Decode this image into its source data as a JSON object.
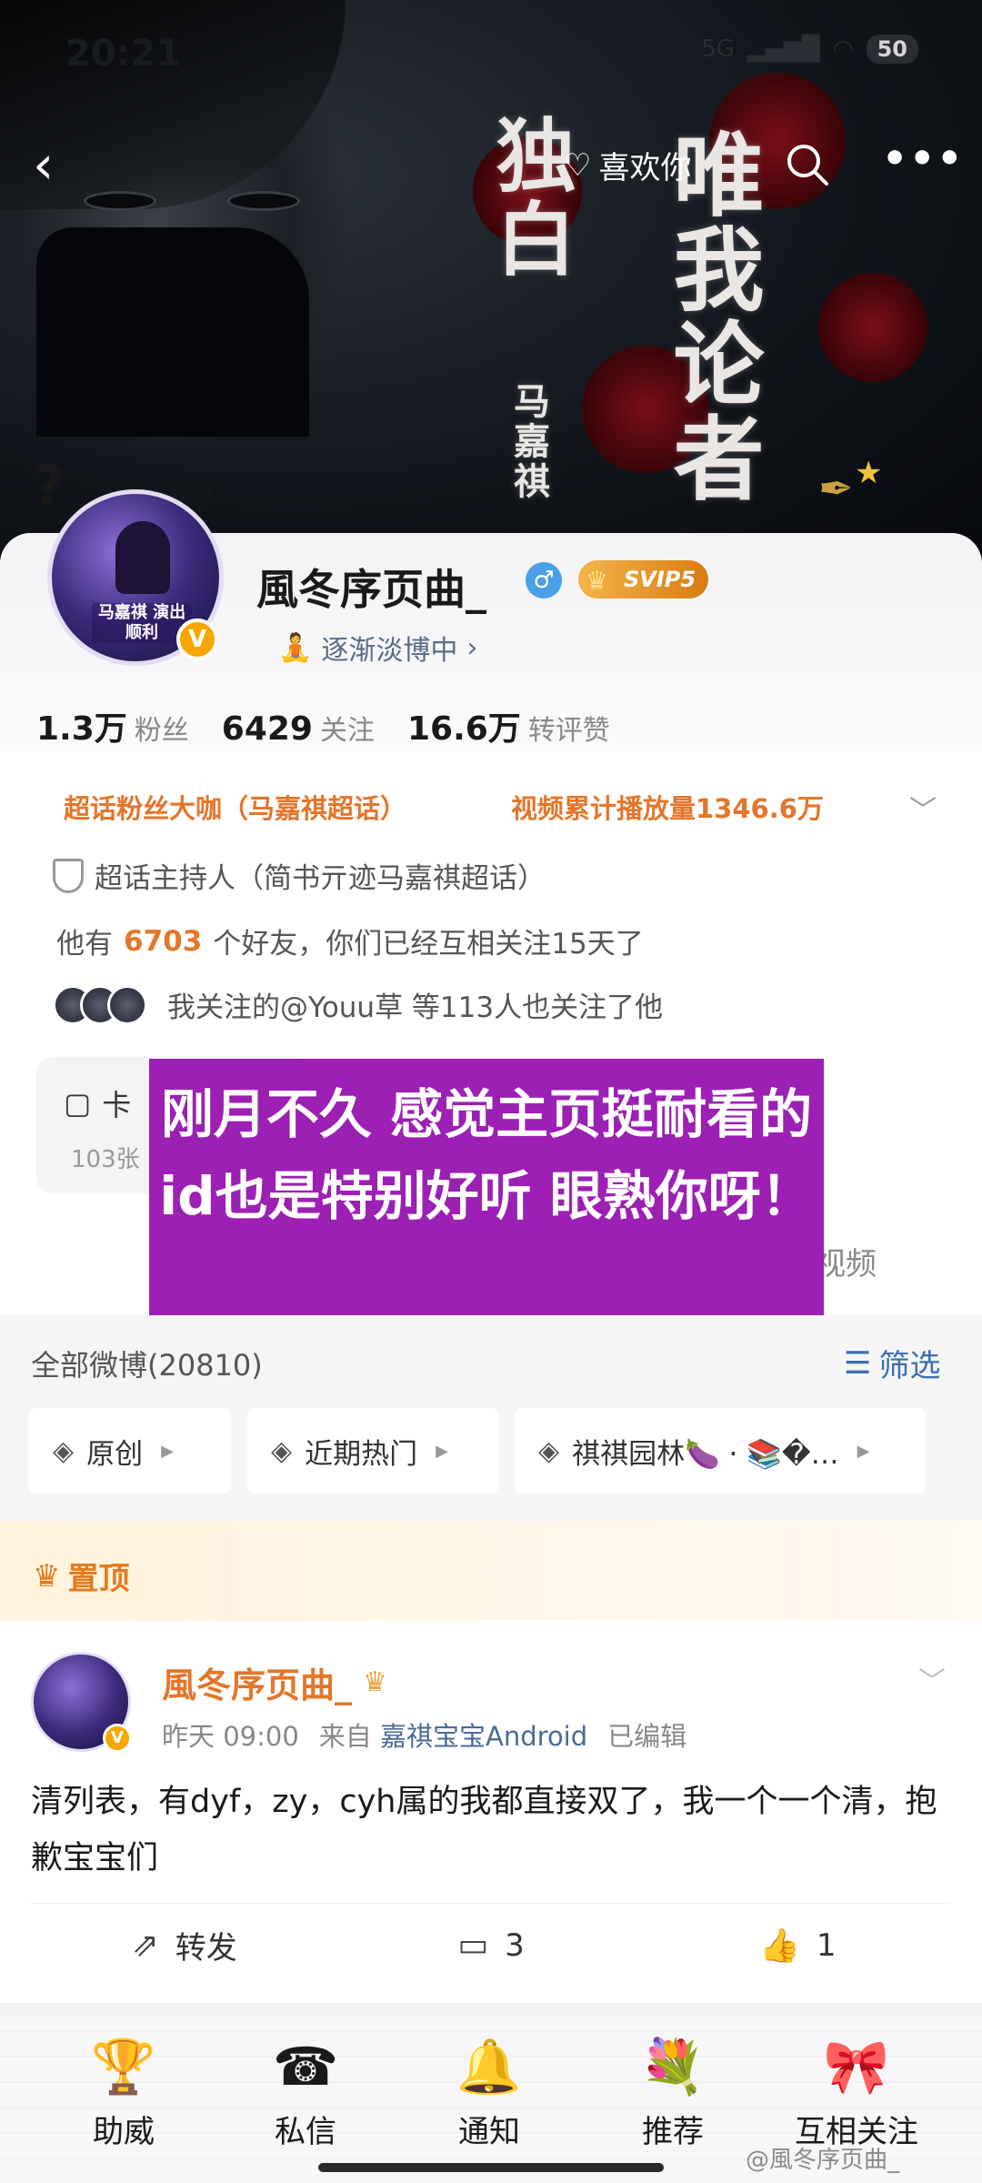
{
  "status_bar": {
    "time": "20:21",
    "network": "5G",
    "battery": "50"
  },
  "cover": {
    "title_left": "独白",
    "title_right": "唯我论者",
    "artist": "马嘉祺"
  },
  "top_nav": {
    "back_icon": "back-chevron-icon",
    "like_label": "喜欢你",
    "search_icon": "search-icon",
    "more_icon": "more-icon"
  },
  "profile": {
    "avatar_caption": "马嘉祺 演出顺利",
    "verified_mark": "V",
    "username": "風冬序页曲_",
    "gender_symbol": "♂",
    "vip_label": "SVIP5",
    "status": "逐渐淡博中",
    "status_chevron": "›",
    "stats": [
      {
        "value": "1.3万",
        "label": "粉丝"
      },
      {
        "value": "6429",
        "label": "关注"
      },
      {
        "value": "16.6万",
        "label": "转评赞"
      }
    ],
    "honor_1": "超话粉丝大咖（马嘉祺超话）",
    "honor_2": "视频累计播放量1346.6万",
    "host_line": "超话主持人（简书亓迹马嘉祺超话）",
    "friends_prefix": "他有",
    "friends_count": "6703",
    "friends_suffix": "个好友，你们已经互相关注15天了",
    "mutual_line": "我关注的@Youu草 等113人也关注了他",
    "card_box_title": "卡",
    "card_box_sub": "103张",
    "video_label": "视频"
  },
  "overlay_text": "刚月不久 感觉主页挺耐看的 id也是特别好听 眼熟你呀！",
  "feed": {
    "title": "全部微博(20810)",
    "filter_label": "筛选",
    "chips": [
      {
        "label": "原创"
      },
      {
        "label": "近期热门"
      },
      {
        "label": "祺祺园林🍆 · 📚�…"
      }
    ]
  },
  "pinned": {
    "label": "置顶"
  },
  "post": {
    "author": "風冬序页曲_",
    "time": "昨天 09:00",
    "source_prefix": "来自",
    "source": "嘉祺宝宝Android",
    "edited": "已编辑",
    "text": "清列表，有dyf，zy，cyh属的我都直接双了，我一个一个清，抱歉宝宝们",
    "repost_label": "转发",
    "comment_count": "3",
    "like_count": "1"
  },
  "bottom_tabs": [
    {
      "label": "助威",
      "icon": "trophy-icon"
    },
    {
      "label": "私信",
      "icon": "telephone-icon"
    },
    {
      "label": "通知",
      "icon": "bell-icon"
    },
    {
      "label": "推荐",
      "icon": "bouquet-icon"
    },
    {
      "label": "互相关注",
      "icon": "ribbon-icon"
    }
  ],
  "watermark": "@風冬序页曲_",
  "colors": {
    "accent_orange": "#e4762a",
    "overlay_purple": "#9c20b4",
    "link_blue": "#3a6fb0"
  }
}
